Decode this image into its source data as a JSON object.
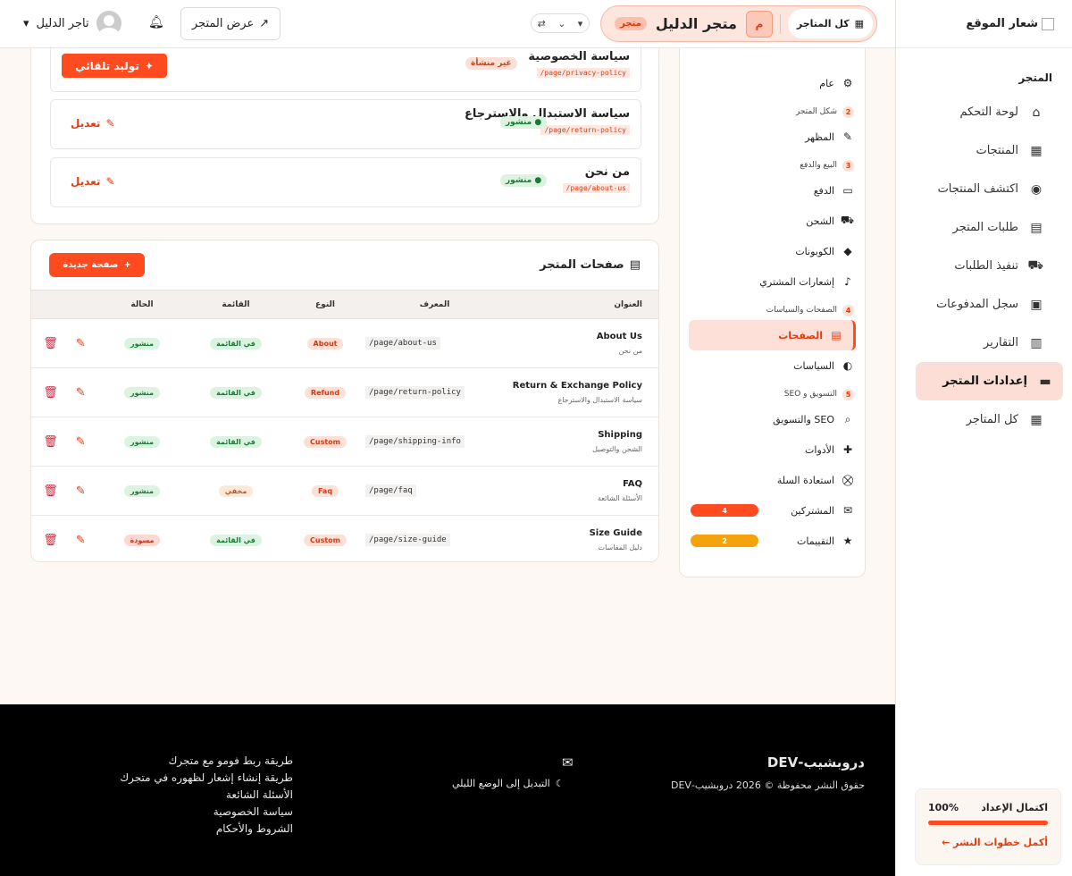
{
  "sidebar": {
    "logo_alt": "شعار الموقع",
    "section_title": "المتجر",
    "items": [
      {
        "label": "لوحة التحكم",
        "icon": "home-icon",
        "glyph": "⌂"
      },
      {
        "label": "المنتجات",
        "icon": "box-icon",
        "glyph": "▦"
      },
      {
        "label": "اكتشف المنتجات",
        "icon": "compass-icon",
        "glyph": "◉"
      },
      {
        "label": "طلبات المتجر",
        "icon": "receipt-icon",
        "glyph": "▤"
      },
      {
        "label": "تنفيذ الطلبات",
        "icon": "truck-icon",
        "glyph": "⛟"
      },
      {
        "label": "سجل المدفوعات",
        "icon": "money-icon",
        "glyph": "▣"
      },
      {
        "label": "التقارير",
        "icon": "chart-icon",
        "glyph": "▥"
      },
      {
        "label": "إعدادات المتجر",
        "icon": "store-icon",
        "glyph": "▬",
        "active": true
      },
      {
        "label": "كل المتاجر",
        "icon": "grid-icon",
        "glyph": "▦"
      }
    ],
    "setup": {
      "label": "اكتمال الإعداد",
      "percent": "100%",
      "progress": 1.0,
      "link": "أكمل خطوات النشر ←"
    }
  },
  "topbar": {
    "all_stores": "كل المتاجر",
    "store_initial": "م",
    "store_name": "متجر الدليل",
    "store_badge": "متجر",
    "view_store": "عرض المتجر",
    "user_name": "تاجر الدليل"
  },
  "submenu": {
    "groups": [
      {
        "num": "",
        "label": "",
        "items": [
          {
            "label": "عام",
            "glyph": "⚙",
            "icon": "gear-icon"
          }
        ]
      },
      {
        "num": "2",
        "label": "شكل المتجر",
        "items": [
          {
            "label": "المظهر",
            "glyph": "✎",
            "icon": "brush-icon"
          }
        ]
      },
      {
        "num": "3",
        "label": "البيع والدفع",
        "items": [
          {
            "label": "الدفع",
            "glyph": "▭",
            "icon": "credit-card-icon"
          },
          {
            "label": "الشحن",
            "glyph": "⛟",
            "icon": "truck-icon"
          },
          {
            "label": "الكوبونات",
            "glyph": "◆",
            "icon": "tags-icon"
          },
          {
            "label": "إشعارات المشتري",
            "glyph": "♪",
            "icon": "bell-icon"
          }
        ]
      },
      {
        "num": "4",
        "label": "الصفحات والسياسات",
        "items": [
          {
            "label": "الصفحات",
            "glyph": "▤",
            "icon": "file-icon",
            "active": true
          },
          {
            "label": "السياسات",
            "glyph": "◐",
            "icon": "shield-icon"
          }
        ]
      },
      {
        "num": "5",
        "label": "التسويق و SEO",
        "items": [
          {
            "label": "SEO والتسويق",
            "glyph": "⌕",
            "icon": "search-icon"
          },
          {
            "label": "الأدوات",
            "glyph": "✚",
            "icon": "puzzle-icon"
          },
          {
            "label": "استعادة السلة",
            "glyph": "⛒",
            "icon": "cart-icon"
          },
          {
            "label": "المشتركين",
            "glyph": "✉",
            "icon": "envelope-icon",
            "count": "4",
            "count_color": "#ff4b1f"
          },
          {
            "label": "التقييمات",
            "glyph": "★",
            "icon": "star-icon",
            "count": "2",
            "count_color": "#f5a30c"
          }
        ]
      }
    ]
  },
  "policies": [
    {
      "title": "سياسة الخصوصية",
      "slug": "page/privacy-policy/",
      "status": "غير منشأة",
      "status_kind": "pend",
      "action": "توليد تلقائي",
      "action_kind": "generate"
    },
    {
      "title": "سياسة الاستبدال والاسترجاع",
      "slug": "page/return-policy/",
      "status": "منشور",
      "status_kind": "pub",
      "action": "تعديل",
      "action_kind": "edit"
    },
    {
      "title": "من نحن",
      "slug": "page/about-us/",
      "status": "منشور",
      "status_kind": "pub",
      "action": "تعديل",
      "action_kind": "edit"
    }
  ],
  "pages": {
    "title": "صفحات المتجر",
    "new_button": "صفحة جديدة",
    "columns": {
      "title": "العنوان",
      "slug": "المعرف",
      "type": "النوع",
      "menu": "القائمة",
      "status": "الحالة"
    },
    "rows": [
      {
        "title": "About Us",
        "subtitle": "من نحن",
        "slug": "page/about-us/",
        "type": "About",
        "menu": "في القائمة",
        "menu_kind": "green",
        "status": "منشور",
        "status_kind": "green"
      },
      {
        "title": "Return & Exchange Policy",
        "subtitle": "سياسة الاستبدال والاسترجاع",
        "slug": "page/return-policy/",
        "type": "Refund",
        "menu": "في القائمة",
        "menu_kind": "green",
        "status": "منشور",
        "status_kind": "green"
      },
      {
        "title": "Shipping",
        "subtitle": "الشحن والتوصيل",
        "slug": "page/shipping-info/",
        "type": "Custom",
        "menu": "في القائمة",
        "menu_kind": "green",
        "status": "منشور",
        "status_kind": "green"
      },
      {
        "title": "FAQ",
        "subtitle": "الأسئلة الشائعة",
        "slug": "page/faq/",
        "type": "Faq",
        "menu": "مخفي",
        "menu_kind": "tan",
        "status": "منشور",
        "status_kind": "green"
      },
      {
        "title": "Size Guide",
        "subtitle": "دليل المقاسات",
        "slug": "page/size-guide/",
        "type": "Custom",
        "menu": "في القائمة",
        "menu_kind": "green",
        "status": "مسودة",
        "status_kind": "red"
      }
    ]
  },
  "footer": {
    "brand": "دروبشيب-DEV",
    "copyright": "حقوق النشر محفوظة © 2026 دروبشيب-DEV",
    "dark_mode": "التبديل إلى الوضع الليلي",
    "links": [
      "طريقة ربط فومو مع متجرك",
      "طريقة إنشاء إشعار لظهوره في متجرك",
      "الأسئلة الشائعة",
      "سياسة الخصوصية",
      "الشروط والأحكام"
    ]
  }
}
